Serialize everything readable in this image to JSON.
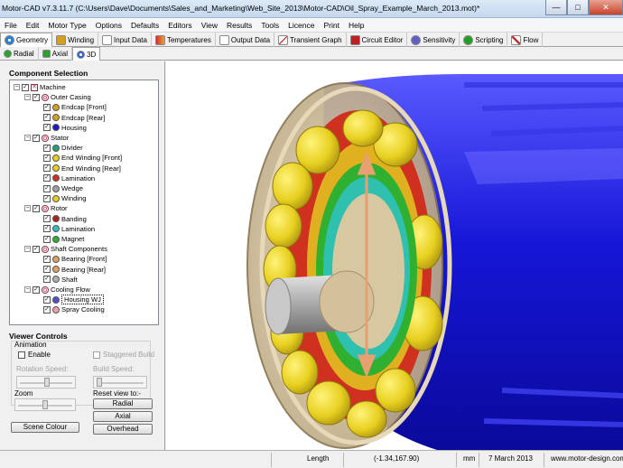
{
  "window": {
    "title": "Motor-CAD v7.3.11.7 (C:\\Users\\Dave\\Documents\\Sales_and_Marketing\\Web_Site_2013\\Motor-CAD\\Oil_Spray_Example_March_2013.mot)*",
    "minimize": "—",
    "maximize": "□",
    "close": "✕"
  },
  "menu": [
    "File",
    "Edit",
    "Motor Type",
    "Options",
    "Defaults",
    "Editors",
    "View",
    "Results",
    "Tools",
    "Licence",
    "Print",
    "Help"
  ],
  "tabs": [
    {
      "label": "Geometry",
      "icon": "geometry-icon",
      "color": "#2a7fd4"
    },
    {
      "label": "Winding",
      "icon": "winding-icon",
      "color": "#d4a020"
    },
    {
      "label": "Input Data",
      "icon": "input-data-icon",
      "color": "#ffffff"
    },
    {
      "label": "Temperatures",
      "icon": "temperatures-icon",
      "color": "#d03030"
    },
    {
      "label": "Output Data",
      "icon": "output-data-icon",
      "color": "#ffffff"
    },
    {
      "label": "Transient Graph",
      "icon": "graph-icon",
      "color": "#e0e0e0"
    },
    {
      "label": "Circuit Editor",
      "icon": "circuit-icon",
      "color": "#c02020"
    },
    {
      "label": "Sensitivity",
      "icon": "sensitivity-icon",
      "color": "#6060c0"
    },
    {
      "label": "Scripting",
      "icon": "scripting-icon",
      "color": "#20a020"
    },
    {
      "label": "Flow",
      "icon": "flow-icon",
      "color": "#c03030"
    }
  ],
  "subtabs": [
    {
      "label": "Radial",
      "icon": "radial-icon"
    },
    {
      "label": "Axial",
      "icon": "axial-icon"
    },
    {
      "label": "3D",
      "icon": "3d-icon"
    }
  ],
  "component_selection": {
    "title": "Component Selection",
    "tree": [
      {
        "label": "Machine",
        "level": 0,
        "kind": "root",
        "expander": "−"
      },
      {
        "label": "Outer Casing",
        "level": 1,
        "kind": "group",
        "expander": "−"
      },
      {
        "label": "Endcap [Front]",
        "level": 2,
        "color": "#d4a020"
      },
      {
        "label": "Endcap [Rear]",
        "level": 2,
        "color": "#d4a020"
      },
      {
        "label": "Housing",
        "level": 2,
        "color": "#1a1acc"
      },
      {
        "label": "Stator",
        "level": 1,
        "kind": "group",
        "expander": "−"
      },
      {
        "label": "Divider",
        "level": 2,
        "color": "#20a080"
      },
      {
        "label": "End Winding [Front]",
        "level": 2,
        "color": "#e8d020"
      },
      {
        "label": "End Winding [Rear]",
        "level": 2,
        "color": "#e8d020"
      },
      {
        "label": "Lamination",
        "level": 2,
        "color": "#d03020"
      },
      {
        "label": "Wedge",
        "level": 2,
        "color": "#a0a0a0"
      },
      {
        "label": "Winding",
        "level": 2,
        "color": "#e8d020"
      },
      {
        "label": "Rotor",
        "level": 1,
        "kind": "group",
        "expander": "−"
      },
      {
        "label": "Banding",
        "level": 2,
        "color": "#b02020"
      },
      {
        "label": "Lamination",
        "level": 2,
        "color": "#30c0c0"
      },
      {
        "label": "Magnet",
        "level": 2,
        "color": "#30b030"
      },
      {
        "label": "Shaft Components",
        "level": 1,
        "kind": "group",
        "expander": "−"
      },
      {
        "label": "Bearing [Front]",
        "level": 2,
        "color": "#e0a060"
      },
      {
        "label": "Bearing [Rear]",
        "level": 2,
        "color": "#e0a060"
      },
      {
        "label": "Shaft",
        "level": 2,
        "color": "#b0b0b0"
      },
      {
        "label": "Cooling Flow",
        "level": 1,
        "kind": "group",
        "expander": "−"
      },
      {
        "label": "Housing WJ",
        "level": 2,
        "color": "#5050d0",
        "selected": true
      },
      {
        "label": "Spray Cooling",
        "level": 2,
        "color": "#f0a0a0"
      }
    ]
  },
  "viewer_controls": {
    "title": "Viewer Controls",
    "animation_label": "Animation",
    "enable_label": "Enable",
    "staggered_label": "Staggered Build",
    "rotation_speed_label": "Rotation Speed:",
    "build_speed_label": "Build Speed:",
    "zoom_label": "Zoom",
    "reset_label": "Reset view to:-",
    "radial_button": "Radial",
    "axial_button": "Axial",
    "overhead_button": "Overhead",
    "scene_colour_button": "Scene Colour"
  },
  "status": {
    "quantity": "Length",
    "coords": "(-1.34,167.90)",
    "unit": "mm",
    "date": "7 March 2013",
    "website": "www.motor-design.com"
  },
  "scene": {
    "housing_color": "#1a1ad8",
    "endcap_color": "#c8b48c",
    "winding_color": "#e8d020",
    "lamination_color": "#d03020",
    "rotor_color": "#30b030",
    "shaft_color": "#b0b0b0",
    "arrow_color": "#e8a070"
  }
}
